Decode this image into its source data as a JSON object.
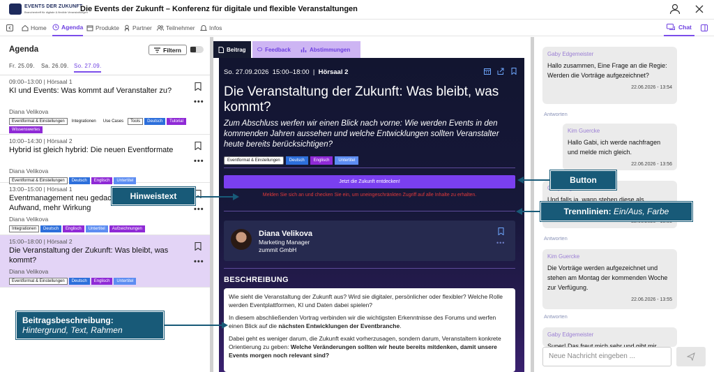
{
  "app": {
    "logo_line1": "EVENTS DER ZUKUNFT",
    "logo_line2": "Branchentreff für digitale & flexible Veranstaltungen",
    "title": "Die Events der Zukunft – Konferenz für digitale und flexible Veranstaltungen"
  },
  "nav": {
    "items": [
      {
        "label": "Home",
        "icon": "home-icon"
      },
      {
        "label": "Agenda",
        "icon": "clock-icon",
        "active": true
      },
      {
        "label": "Produkte",
        "icon": "box-icon"
      },
      {
        "label": "Partner",
        "icon": "partner-icon"
      },
      {
        "label": "Teilnehmer",
        "icon": "people-icon"
      },
      {
        "label": "Infos",
        "icon": "bell-icon"
      }
    ],
    "chat_label": "Chat"
  },
  "agenda": {
    "title": "Agenda",
    "filter_label": "Filtern",
    "days": [
      "Fr. 25.09.",
      "Sa. 26.09.",
      "So. 27.09."
    ],
    "active_day": 2,
    "sessions": [
      {
        "time": "09:00–13:00 | Hörsaal 1",
        "title": "KI und Events: Was kommt auf Veranstalter zu?",
        "speaker": "Diana Velikova",
        "tags": [
          {
            "t": "Eventformat & Einstellungen",
            "c": "outline"
          },
          {
            "t": "Integrationen",
            "c": "plain"
          },
          {
            "t": "Use Cases",
            "c": "plain"
          },
          {
            "t": "Tools",
            "c": "outline"
          },
          {
            "t": "Deutsch",
            "c": "blue"
          },
          {
            "t": "Tutorial",
            "c": "purple"
          },
          {
            "t": "Wissenswertes",
            "c": "purple"
          }
        ]
      },
      {
        "time": "10:00–14:30 | Hörsaal 2",
        "title": "Hybrid ist gleich hybrid: Die neuen Eventformate",
        "speaker": "Diana Velikova",
        "tags": [
          {
            "t": "Eventformat & Einstellungen",
            "c": "outline"
          },
          {
            "t": "Deutsch",
            "c": "blue"
          },
          {
            "t": "Englisch",
            "c": "purple"
          },
          {
            "t": "Untertitel",
            "c": "lblue"
          }
        ]
      },
      {
        "time": "13:00–15:00 | Hörsaal 1",
        "title": "Eventmanagement neu gedacht: Weniger Aufwand, mehr Wirkung",
        "speaker": "Diana Velikova",
        "tags": [
          {
            "t": "Integrationen",
            "c": "outline"
          },
          {
            "t": "Deutsch",
            "c": "blue"
          },
          {
            "t": "Englisch",
            "c": "purple"
          },
          {
            "t": "Untertitel",
            "c": "lblue"
          },
          {
            "t": "Aufzeichnungen",
            "c": "purple"
          }
        ]
      },
      {
        "time": "15:00–18:00 | Hörsaal 2",
        "title": "Die Veranstaltung der Zukunft: Was bleibt, was kommt?",
        "speaker": "Diana Velikova",
        "selected": true,
        "tags": [
          {
            "t": "Eventformat & Einstellungen",
            "c": "outline"
          },
          {
            "t": "Deutsch",
            "c": "blue"
          },
          {
            "t": "Englisch",
            "c": "purple"
          },
          {
            "t": "Untertitel",
            "c": "lblue"
          }
        ]
      }
    ]
  },
  "content_tabs": [
    "Beitrag",
    "Feedback",
    "Abstimmungen"
  ],
  "post": {
    "date": "So. 27.09.2026",
    "time": "15:00–18:00",
    "room": "Hörsaal 2",
    "title": "Die Veranstaltung der Zukunft: Was bleibt, was kommt?",
    "subtitle": "Zum Abschluss werfen wir einen Blick nach vorne: Wie werden Events in den kommenden Jahren aussehen und welche Entwicklungen sollten Veranstalter heute bereits berücksichtigen?",
    "tags": [
      {
        "t": "Eventformat & Einstellungen",
        "c": "outline"
      },
      {
        "t": "Deutsch",
        "c": "blue"
      },
      {
        "t": "Englisch",
        "c": "purple"
      },
      {
        "t": "Untertitel",
        "c": "lblue"
      }
    ],
    "cta_label": "Jetzt die Zukunft entdecken!",
    "hint": "Melden Sie sich an und checken Sie ein, um uneingeschränkten Zugriff auf alle Inhalte zu erhalten.",
    "speaker": {
      "name": "Diana Velikova",
      "role": "Marketing Manager",
      "company": "zummit GmbH"
    },
    "desc_heading": "BESCHREIBUNG",
    "desc_p1": "Wie sieht die Veranstaltung der Zukunft aus? Wird sie digitaler, persönlicher oder flexibler? Welche Rolle werden Eventplattformen, KI und Daten dabei spielen?",
    "desc_p2_a": "In diesem abschließenden Vortrag verbinden wir die wichtigsten Erkenntnisse des Forums und werfen einen Blick auf die ",
    "desc_p2_b": "nächsten Entwicklungen der Eventbranche",
    "desc_p2_c": ".",
    "desc_p3_a": "Dabei geht es weniger darum, die Zukunft exakt vorherzusagen, sondern darum, Veranstaltern konkrete Orientierung zu geben: ",
    "desc_p3_b": "Welche Veränderungen sollten wir heute bereits mitdenken, damit unsere Events morgen noch relevant sind?"
  },
  "chat": {
    "messages": [
      {
        "author": "Gaby Edgemeister",
        "text": "Hallo zusammen, Eine Frage an die Regie: Werden die Vorträge aufgezeichnet?",
        "time": "22.06.2026 - 13:54"
      },
      {
        "author": "Kim Guercke",
        "text": "Hallo Gabi, ich werde nachfragen und melde mich gleich.",
        "time": "22.06.2026 - 13:56"
      },
      {
        "author": "Gaby Edgemeister",
        "text": "Und falls ja, wann stehen diese als",
        "time": "22.06.2026 - 13:55"
      },
      {
        "author": "Kim Guercke",
        "text": "Die Vorträge werden aufgezeichnet und stehen am Montag der kommenden Woche zur Verfügung.",
        "time": "22.06.2026 - 13:55"
      },
      {
        "author": "Gaby Edgemeister",
        "text": "Super! Das freut mich sehr und gibt mir"
      }
    ],
    "reply_label": "Antworten",
    "input_placeholder": "Neue Nachricht eingeben ..."
  },
  "callouts": {
    "button": "Button",
    "hint": "Hinweistext",
    "dividers_a": "Trennlinien: ",
    "dividers_b": "Ein/Aus, Farbe",
    "desc_a": "Beitragsbeschreibung:",
    "desc_b": "Hintergrund, Text, Rahmen"
  },
  "colors": {
    "accent": "#7b4dea",
    "post_bg": "#151a30",
    "callout": "#185a78",
    "hint_red": "#e23a3a"
  }
}
